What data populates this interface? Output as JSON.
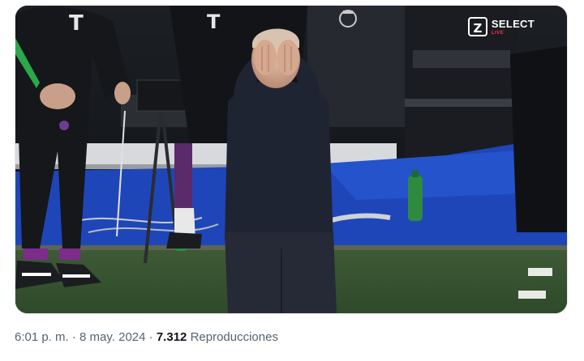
{
  "broadcast": {
    "brand_mark": "Z",
    "brand_name": "SELECT",
    "brand_sub": "LIVE"
  },
  "tweet_meta": {
    "time": "6:01 p. m.",
    "separator_1": "·",
    "date": "8 may. 2024",
    "separator_2": "·",
    "views_count": "7.312",
    "views_label": "Reproducciones"
  }
}
